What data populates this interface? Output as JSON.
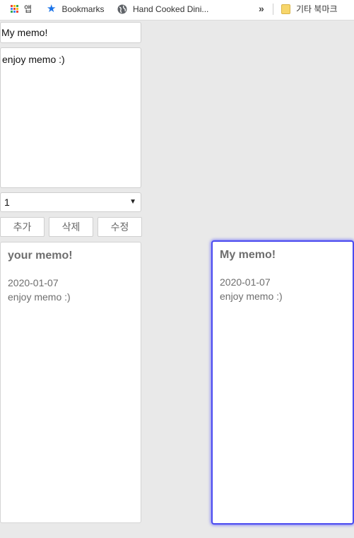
{
  "bookmarks_bar": {
    "apps_label": "앱",
    "items": [
      {
        "label": "Bookmarks",
        "icon": "star-icon"
      },
      {
        "label": "Hand Cooked Dini...",
        "icon": "globe-icon"
      }
    ],
    "overflow": "»",
    "other_bookmarks": "기타 북마크"
  },
  "editor": {
    "title_value": "My memo!",
    "body_value": "enjoy memo :)",
    "select_value": "1",
    "buttons": {
      "add": "추가",
      "delete": "삭제",
      "edit": "수정"
    }
  },
  "memos": [
    {
      "title": "your memo!",
      "date": "2020-01-07",
      "text": "enjoy memo :)"
    },
    {
      "title": "My memo!",
      "date": "2020-01-07",
      "text": "enjoy memo :)"
    }
  ],
  "colors": {
    "background": "#e9e9e9",
    "selected_border": "#4b4bf0",
    "card_text": "#6e6e6e"
  }
}
